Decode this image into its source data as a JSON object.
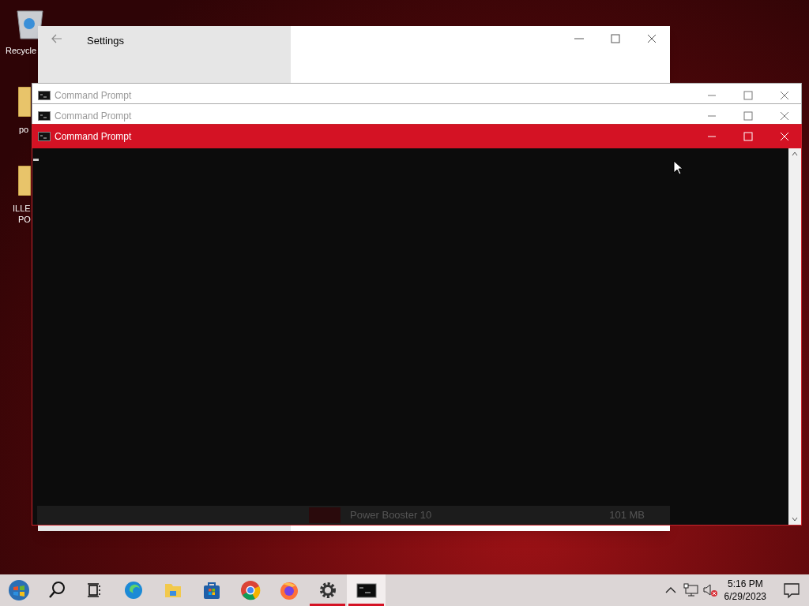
{
  "desktop_icons": [
    {
      "kind": "recycle",
      "lines": [
        "Recycle"
      ]
    },
    {
      "kind": "folder",
      "lines": [
        "po"
      ]
    },
    {
      "kind": "folder",
      "lines": [
        "ILLE",
        "PO"
      ]
    }
  ],
  "settings_window": {
    "title": "Settings"
  },
  "command_windows": [
    {
      "title": "Command Prompt",
      "active": false
    },
    {
      "title": "Command Prompt",
      "active": false
    },
    {
      "title": "Command Prompt",
      "active": true
    }
  ],
  "see_through_row": {
    "name": "Power Booster 10",
    "size": "101 MB"
  },
  "taskbar": {
    "apps": [
      {
        "kind": "start",
        "running": false,
        "active": false
      },
      {
        "kind": "search",
        "running": false,
        "active": false
      },
      {
        "kind": "taskview",
        "running": false,
        "active": false
      },
      {
        "kind": "edge",
        "running": false,
        "active": false
      },
      {
        "kind": "explorer",
        "running": false,
        "active": false
      },
      {
        "kind": "store",
        "running": false,
        "active": false
      },
      {
        "kind": "chrome",
        "running": false,
        "active": false
      },
      {
        "kind": "firefox",
        "running": false,
        "active": false
      },
      {
        "kind": "settings",
        "running": true,
        "active": false
      },
      {
        "kind": "terminal",
        "running": true,
        "active": true
      }
    ],
    "time": "5:16 PM",
    "date": "6/29/2023"
  }
}
